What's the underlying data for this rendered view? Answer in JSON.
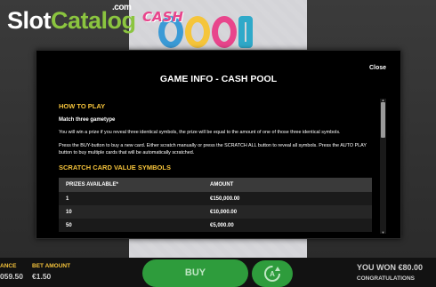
{
  "site_logo": {
    "slot": "Slot",
    "catalog": "Catalog",
    "com": ".com"
  },
  "game_logo": {
    "cash": "CASH",
    "pool": "POOL"
  },
  "modal": {
    "close_label": "Close",
    "title": "GAME INFO - CASH POOL",
    "how_to_play": "HOW TO PLAY",
    "match_heading": "Match three gametype",
    "para1": "You will win a prize if you reveal three identical symbols, the prize will be equal to the amount of one of those three identical symbols.",
    "para2": "Press the BUY-button to buy a new card. Either scratch manually or press the SCRATCH ALL button to reveal all symbols. Press the AUTO PLAY button to buy multiple cards that will be automatically scratched.",
    "scratch_heading": "SCRATCH CARD VALUE SYMBOLS",
    "table": {
      "headers": [
        "PRIZES AVAILABLE*",
        "AMOUNT"
      ],
      "rows": [
        [
          "1",
          "€150,000.00"
        ],
        [
          "10",
          "€10,000.00"
        ],
        [
          "50",
          "€5,000.00"
        ]
      ]
    },
    "scroll_position": 0.05
  },
  "bottom_bar": {
    "balance_label": "ANCE",
    "balance_value": "059.50",
    "bet_label": "BET AMOUNT",
    "bet_value": "€1.50",
    "buy_label": "BUY",
    "auto_icon": "autoplay-icon",
    "won_label": "YOU WON €80.00",
    "congrats": "CONGRATULATIONS"
  },
  "colors": {
    "accent_yellow": "#f5c33b",
    "button_green": "#2e9c3c",
    "logo_green": "#8bc53f"
  }
}
